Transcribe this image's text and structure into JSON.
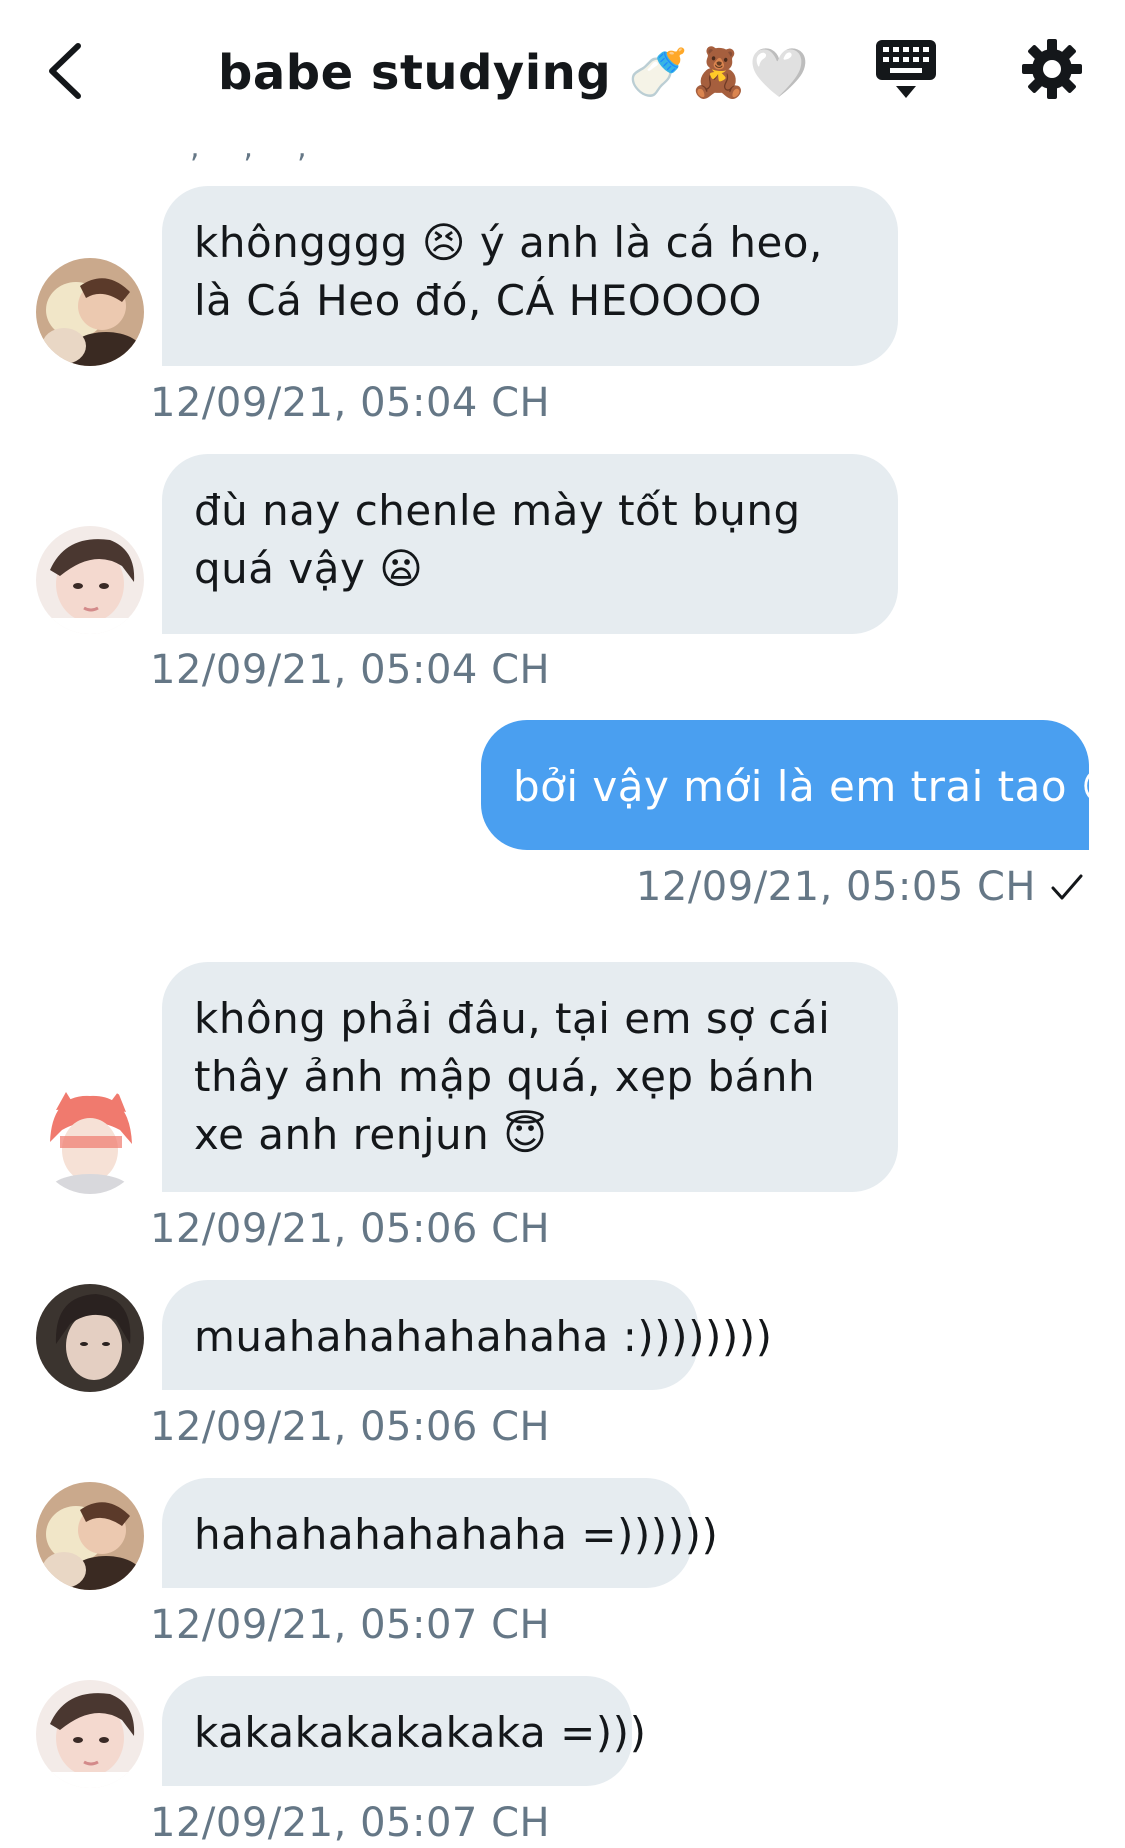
{
  "header": {
    "title": "babe studying 🍼🧸🤍",
    "back_icon": "chevron-left-icon",
    "keyboard_icon": "keyboard-icon",
    "settings_icon": "gear-icon"
  },
  "colors": {
    "incoming_bubble": "#e6ecf0",
    "outgoing_bubble": "#4a9ff0",
    "timestamp": "#657786",
    "text": "#14171a"
  },
  "messages": [
    {
      "sender": "other",
      "avatar": "avatar-1",
      "text": "khôngggg 😣 ý anh là cá heo, là Cá Heo đó, CÁ HEOOOO",
      "timestamp": "12/09/21, 05:04 CH"
    },
    {
      "sender": "other",
      "avatar": "avatar-2",
      "text": "đù nay chenle mày tốt bụng quá vậy 😦",
      "timestamp": "12/09/21, 05:04 CH"
    },
    {
      "sender": "me",
      "text": "bởi vậy mới là em trai tao 😍",
      "timestamp": "12/09/21, 05:05 CH",
      "status_icon": "check-icon"
    },
    {
      "sender": "other",
      "avatar": "avatar-3",
      "text": "không phải đâu, tại em sợ cái thây ảnh mập quá, xẹp bánh xe anh renjun 😇",
      "timestamp": "12/09/21, 05:06 CH"
    },
    {
      "sender": "other",
      "avatar": "avatar-4",
      "text": "muahahahahahaha :))))))))",
      "timestamp": "12/09/21, 05:06 CH"
    },
    {
      "sender": "other",
      "avatar": "avatar-1",
      "text": "hahahahahahaha =))))))",
      "timestamp": "12/09/21, 05:07 CH"
    },
    {
      "sender": "other",
      "avatar": "avatar-2",
      "text": "kakakakakakaka =)))",
      "timestamp": "12/09/21, 05:07 CH"
    }
  ]
}
